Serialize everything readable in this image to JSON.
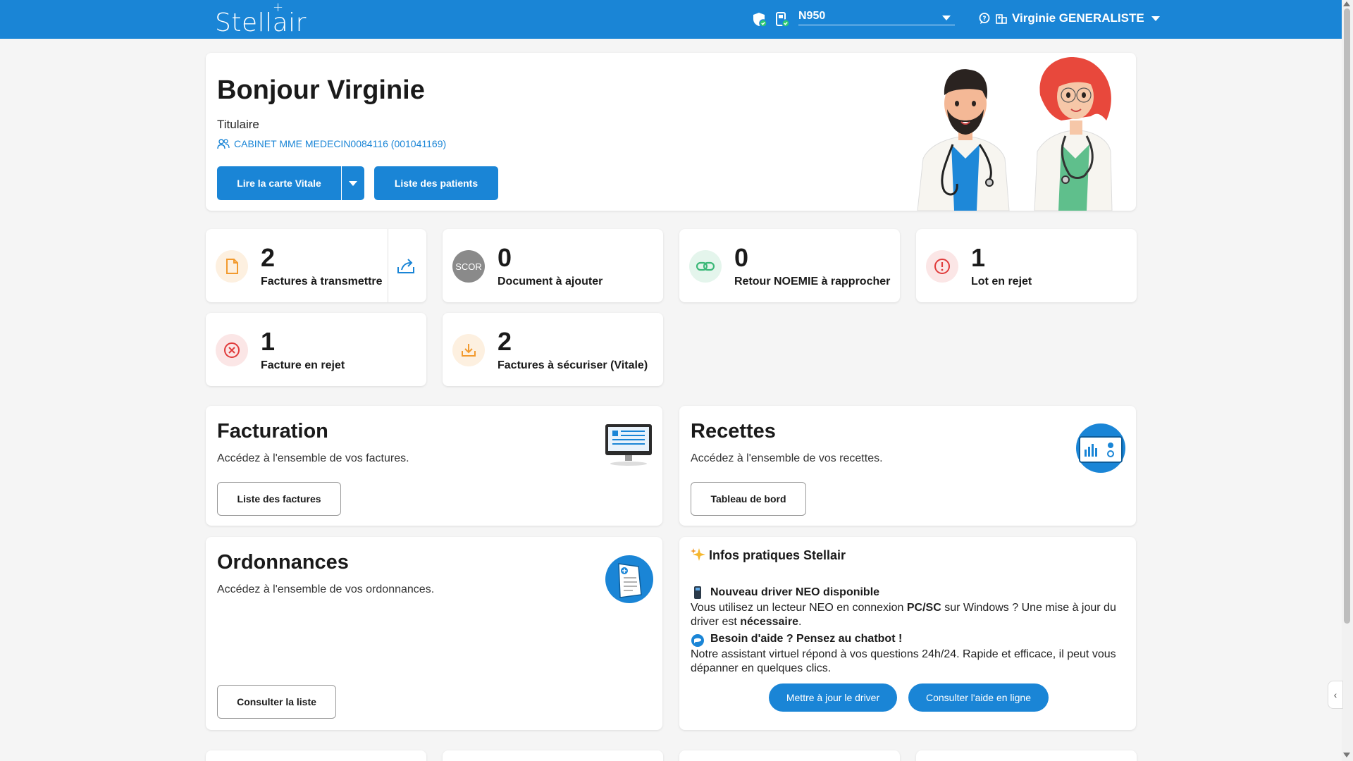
{
  "header": {
    "logo": "Stellair",
    "reader_value": "N950",
    "user_name": "Virginie GENERALISTE"
  },
  "welcome": {
    "greeting": "Bonjour Virginie",
    "role": "Titulaire",
    "cabinet": "CABINET MME MEDECIN0084116 (001041169)",
    "btn_read_vitale": "Lire la carte Vitale",
    "btn_patients": "Liste des patients"
  },
  "stats": [
    {
      "count": "2",
      "label": "Factures à transmettre",
      "color": "#f29a2e"
    },
    {
      "count": "0",
      "label": "Document à ajouter",
      "icon_text": "SCOR",
      "color": "#888888"
    },
    {
      "count": "0",
      "label": "Retour NOEMIE à rapprocher",
      "color": "#3cb878"
    },
    {
      "count": "1",
      "label": "Lot en rejet",
      "color": "#e03b3b"
    },
    {
      "count": "1",
      "label": "Facture en rejet",
      "color": "#e03b3b"
    },
    {
      "count": "2",
      "label": "Factures à sécuriser (Vitale)",
      "color": "#f29a2e"
    }
  ],
  "facturation": {
    "title": "Facturation",
    "desc": "Accédez à l'ensemble de vos factures.",
    "btn": "Liste des factures"
  },
  "recettes": {
    "title": "Recettes",
    "desc": "Accédez à l'ensemble de vos recettes.",
    "btn": "Tableau de bord"
  },
  "ordonnances": {
    "title": "Ordonnances",
    "desc": "Accédez à l'ensemble de vos ordonnances.",
    "btn": "Consulter la liste"
  },
  "infos": {
    "title": "Infos pratiques Stellair",
    "item1_title": "Nouveau driver NEO disponible",
    "item1_text_a": "Vous utilisez un lecteur NEO en connexion ",
    "item1_text_b": "PC/SC",
    "item1_text_c": " sur Windows ? Une mise à jour du driver est ",
    "item1_text_d": "nécessaire",
    "item1_text_e": ".",
    "item2_title": "Besoin d'aide ? Pensez au chatbot !",
    "item2_text": "Notre assistant virtuel répond à vos questions 24h/24. Rapide et efficace, il peut vous dépanner en quelques clics.",
    "btn_driver": "Mettre à jour le driver",
    "btn_help": "Consulter l'aide en ligne"
  },
  "colors": {
    "primary": "#1a85d6",
    "background": "#f5f5f5"
  }
}
